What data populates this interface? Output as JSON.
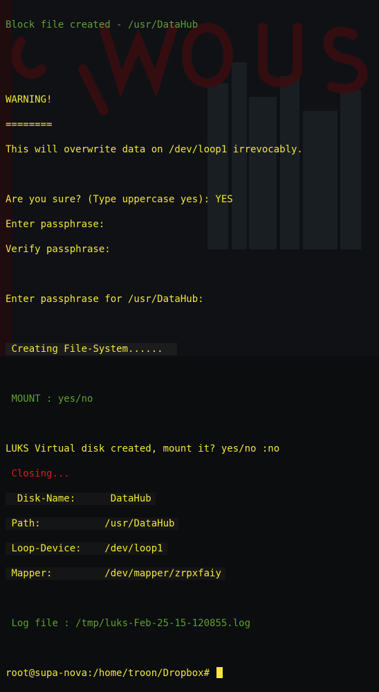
{
  "terminal": {
    "lines": {
      "block_created": "Block file created - /usr/DataHub",
      "warning": "WARNING!",
      "rule": "========",
      "overwrite": "This will overwrite data on /dev/loop1 irrevocably.",
      "are_you_sure": "Are you sure? (Type uppercase yes): YES",
      "enter_pass": "Enter passphrase:",
      "verify_pass": "Verify passphrase:",
      "enter_pass_for": "Enter passphrase for /usr/DataHub:",
      "creating_fs": "Creating File-System......",
      "mount": "MOUNT : yes/no",
      "luks_created": "LUKS Virtual disk created, mount it? yes/no :no",
      "closing": "Closing...",
      "disk_name": "Disk-Name:      DataHub",
      "path": "Path:           /usr/DataHub",
      "loop_device": "Loop-Device:    /dev/loop1",
      "mapper": "Mapper:         /dev/mapper/zrpxfaiy",
      "log_file": "Log file : /tmp/luks-Feb-25-15-120855.log",
      "prompt": "root@supa-nova:/home/troon/Dropbox# "
    }
  },
  "colors": {
    "yellow": "#f0e83a",
    "green": "#5fa033",
    "white": "#e8e8e8",
    "red": "#d42121"
  }
}
